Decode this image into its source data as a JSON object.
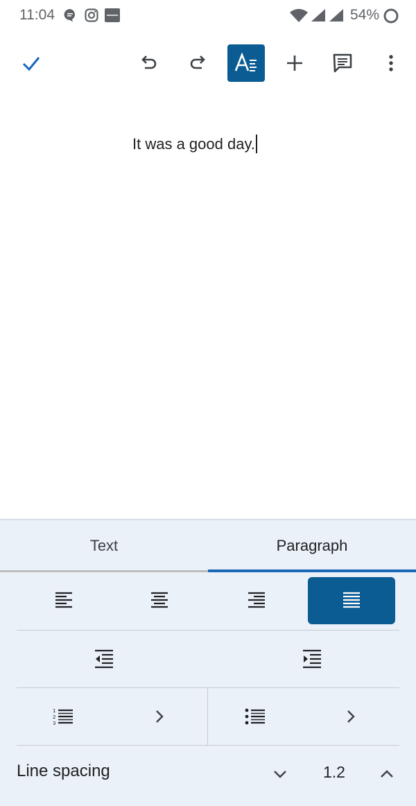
{
  "status_bar": {
    "time": "11:04",
    "battery": "54%",
    "icons": [
      "chat-notification-icon",
      "instagram-icon",
      "news-app-icon",
      "wifi-icon",
      "signal-icon",
      "signal-icon-2",
      "battery-icon"
    ]
  },
  "toolbar": {
    "icons": [
      "check-icon",
      "undo-icon",
      "redo-icon",
      "text-format-icon",
      "add-icon",
      "comment-icon",
      "more-vert-icon"
    ],
    "active": "text-format-icon",
    "accent": "#0b5c93"
  },
  "document": {
    "text": "It was a good day."
  },
  "format_panel": {
    "tabs": [
      {
        "label": "Text",
        "selected": false
      },
      {
        "label": "Paragraph",
        "selected": true
      }
    ],
    "alignment": {
      "options": [
        "align-left-icon",
        "align-center-icon",
        "align-right-icon",
        "align-justify-icon"
      ],
      "selected": "align-justify-icon"
    },
    "indent": [
      "decrease-indent-icon",
      "increase-indent-icon"
    ],
    "lists": [
      "numbered-list-icon",
      "bulleted-list-icon"
    ],
    "line_spacing": {
      "label": "Line spacing",
      "value": "1.2"
    },
    "background": "#ebf1f8",
    "tab_indicator_color": "#1a67b8"
  }
}
